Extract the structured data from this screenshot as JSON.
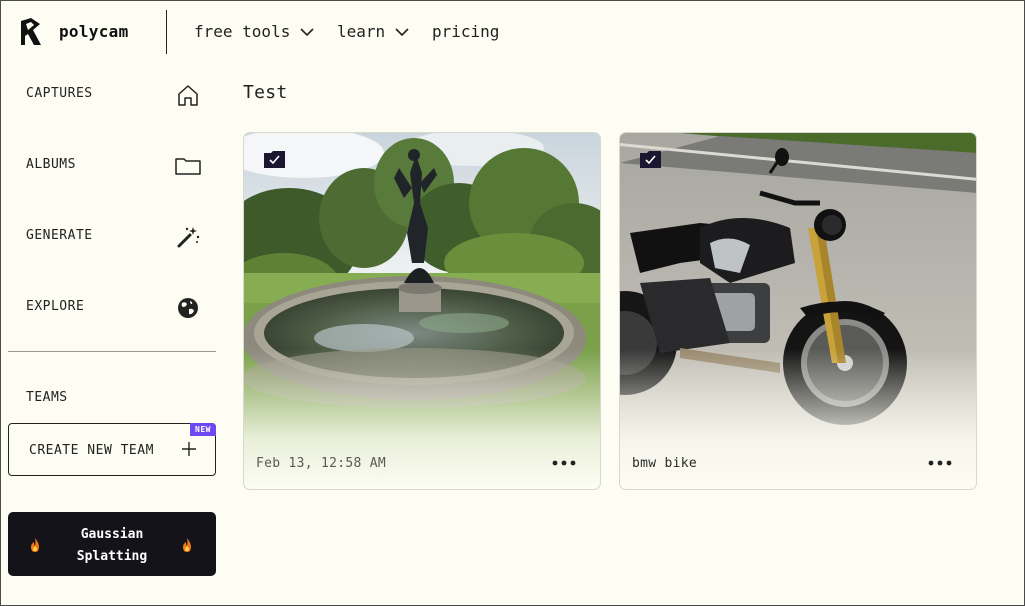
{
  "brand": {
    "name": "polycam"
  },
  "nav": {
    "items": [
      {
        "label": "free tools",
        "has_dropdown": true
      },
      {
        "label": "learn",
        "has_dropdown": true
      },
      {
        "label": "pricing",
        "has_dropdown": false
      }
    ]
  },
  "sidebar": {
    "items": [
      {
        "label": "CAPTURES",
        "icon": "home-icon"
      },
      {
        "label": "ALBUMS",
        "icon": "folder-icon"
      },
      {
        "label": "GENERATE",
        "icon": "magic-wand-icon"
      },
      {
        "label": "EXPLORE",
        "icon": "globe-icon"
      }
    ],
    "teams_label": "TEAMS",
    "create_team": {
      "label": "CREATE NEW TEAM",
      "badge": "NEW"
    },
    "promo": {
      "line1": "Gaussian",
      "line2": "Splatting"
    }
  },
  "main": {
    "title": "Test",
    "cards": [
      {
        "caption": "Feb 13, 12:58 AM",
        "icon": "album-check-icon"
      },
      {
        "caption": "bmw bike",
        "icon": "album-check-icon"
      }
    ]
  },
  "colors": {
    "background": "#fdfdf3",
    "badge": "#6e48f0",
    "promo_bg": "#15131a",
    "flame": "#f07a1a"
  }
}
